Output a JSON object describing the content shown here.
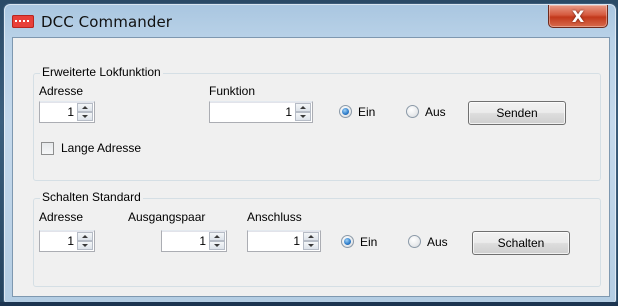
{
  "window": {
    "title": "DCC Commander",
    "close_label": "X"
  },
  "group_lok": {
    "title": "Erweiterte Lokfunktion",
    "adresse_label": "Adresse",
    "adresse_value": "1",
    "funktion_label": "Funktion",
    "funktion_value": "1",
    "ein_label": "Ein",
    "aus_label": "Aus",
    "selected": "Ein",
    "lange_adresse_label": "Lange Adresse",
    "lange_adresse_checked": false,
    "send_label": "Senden"
  },
  "group_schalten": {
    "title": "Schalten Standard",
    "adresse_label": "Adresse",
    "adresse_value": "1",
    "ausgangspaar_label": "Ausgangspaar",
    "ausgangspaar_value": "1",
    "anschluss_label": "Anschluss",
    "anschluss_value": "1",
    "ein_label": "Ein",
    "aus_label": "Aus",
    "selected": "Ein",
    "schalten_label": "Schalten"
  },
  "icons": {
    "app": "dcc-app-icon",
    "close": "close-icon",
    "spin": "spinner-arrows-icon"
  },
  "colors": {
    "close_button": "#c2381b",
    "app_icon": "#e8403a",
    "radio_checked": "#2a7ac9"
  }
}
